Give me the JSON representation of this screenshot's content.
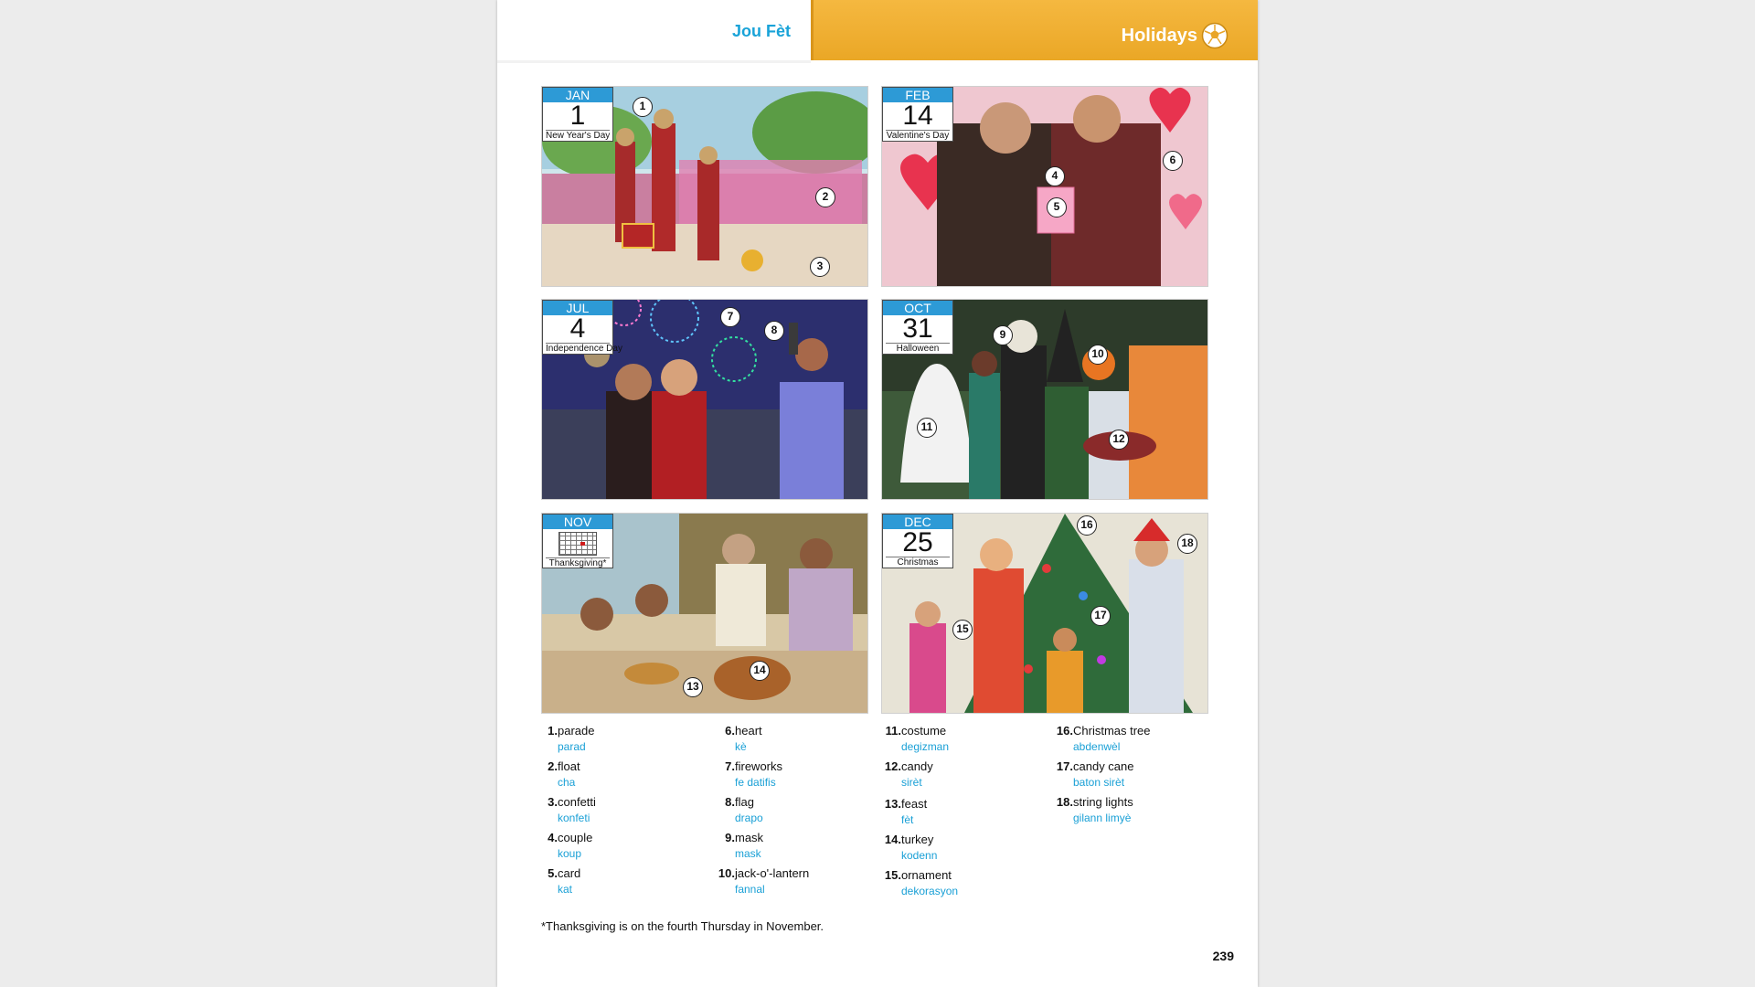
{
  "header": {
    "left_title": "Jou Fèt",
    "right_title": "Holidays",
    "icon": "soccer-ball-icon",
    "accent_color": "#f0b030",
    "link_color": "#19a3d8"
  },
  "panels": [
    {
      "month": "JAN",
      "day": "1",
      "name": "New Year's Day",
      "markers": [
        "1",
        "2",
        "3"
      ]
    },
    {
      "month": "FEB",
      "day": "14",
      "name": "Valentine's Day",
      "markers": [
        "4",
        "5",
        "6"
      ]
    },
    {
      "month": "JUL",
      "day": "4",
      "name": "Independence  Day",
      "markers": [
        "7",
        "8"
      ]
    },
    {
      "month": "OCT",
      "day": "31",
      "name": "Halloween",
      "markers": [
        "9",
        "10",
        "11",
        "12"
      ]
    },
    {
      "month": "NOV",
      "day": "",
      "name": "Thanksgiving*",
      "markers": [
        "13",
        "14"
      ]
    },
    {
      "month": "DEC",
      "day": "25",
      "name": "Christmas",
      "markers": [
        "15",
        "16",
        "17",
        "18"
      ]
    }
  ],
  "vocabulary": [
    [
      {
        "num": "1.",
        "en": "parade",
        "ht": "parad"
      },
      {
        "num": "2.",
        "en": "float",
        "ht": "cha"
      },
      {
        "num": "3.",
        "en": "confetti",
        "ht": "konfeti"
      },
      {
        "num": "4.",
        "en": "couple",
        "ht": "koup"
      },
      {
        "num": "5.",
        "en": "card",
        "ht": "kat"
      }
    ],
    [
      {
        "num": "6.",
        "en": "heart",
        "ht": "kè"
      },
      {
        "num": "7.",
        "en": "fireworks",
        "ht": "fe datifis"
      },
      {
        "num": "8.",
        "en": "flag",
        "ht": "drapo"
      },
      {
        "num": "9.",
        "en": "mask",
        "ht": "mask"
      },
      {
        "num": "10.",
        "en": "jack-o'-lantern",
        "ht": "fannal"
      }
    ],
    [
      {
        "num": "11.",
        "en": "costume",
        "ht": "degizman"
      },
      {
        "num": "12.",
        "en": "candy",
        "ht": "sirèt"
      },
      {
        "num": "13.",
        "en": "feast",
        "ht": "fèt"
      },
      {
        "num": "14.",
        "en": "turkey",
        "ht": "kodenn"
      },
      {
        "num": "15.",
        "en": "ornament",
        "ht": "dekorasyon"
      }
    ],
    [
      {
        "num": "16.",
        "en": "Christmas tree",
        "ht": "abdenwèl"
      },
      {
        "num": "17.",
        "en": "candy cane",
        "ht": "baton sirèt"
      },
      {
        "num": "18.",
        "en": "string lights",
        "ht": "gilann limyè"
      }
    ]
  ],
  "footnote": "*Thanksgiving is on the fourth Thursday in November.",
  "page_number": "239"
}
